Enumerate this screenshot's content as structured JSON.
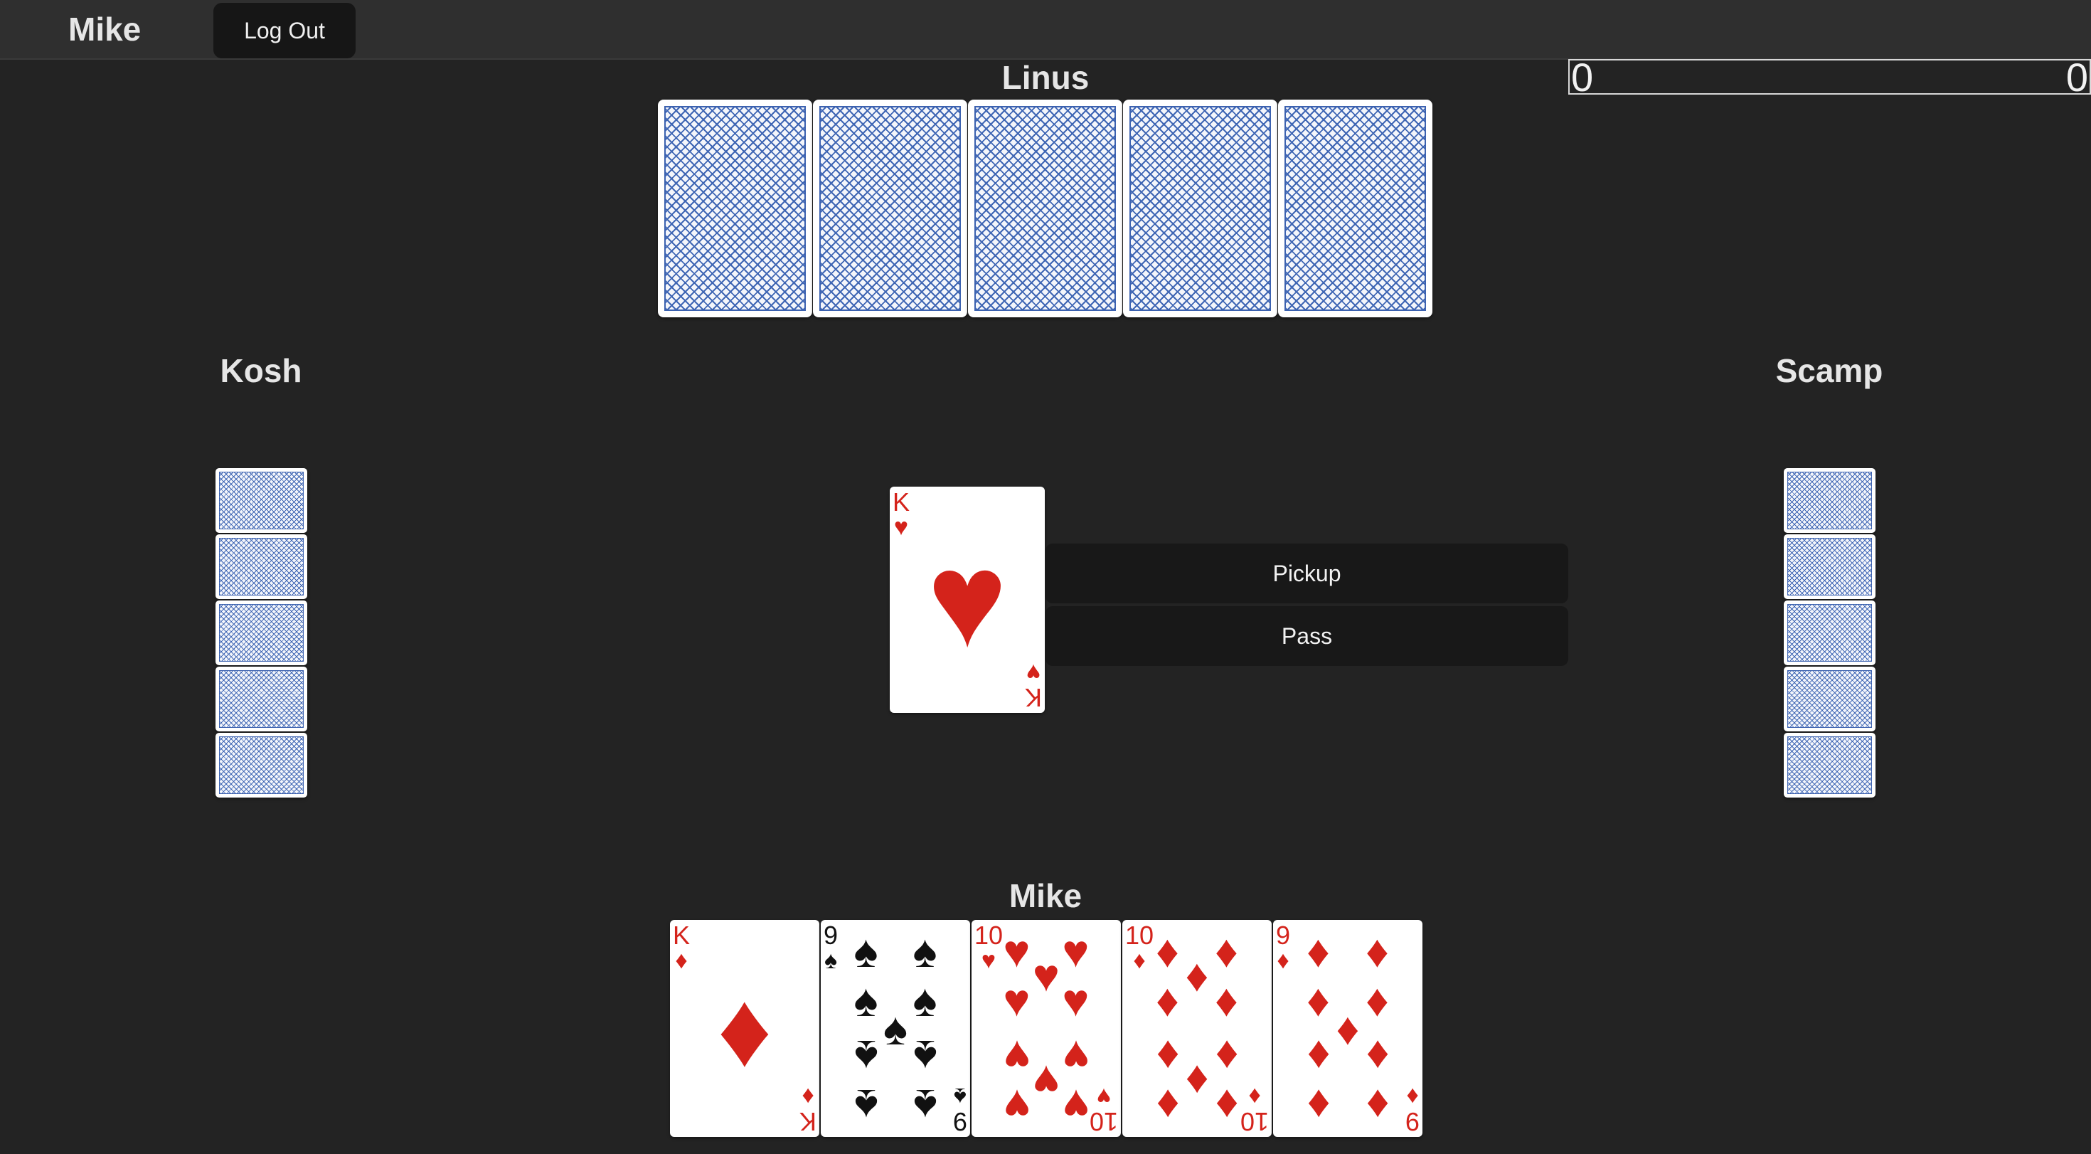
{
  "header": {
    "user_name": "Mike",
    "logout_label": "Log Out"
  },
  "scoreboard": {
    "team_a_score": "0",
    "team_b_score": "0"
  },
  "players": {
    "north": {
      "name": "Linus",
      "card_count": 5
    },
    "west": {
      "name": "Kosh",
      "card_count": 5
    },
    "east": {
      "name": "Scamp",
      "card_count": 5
    },
    "south": {
      "name": "Mike"
    }
  },
  "turned_up_card": {
    "rank": "K",
    "suit": "♥",
    "color": "red"
  },
  "actions": {
    "pickup_label": "Pickup",
    "pass_label": "Pass"
  },
  "hand": [
    {
      "rank": "K",
      "suit": "♦",
      "color": "red",
      "pips": 0
    },
    {
      "rank": "9",
      "suit": "♠",
      "color": "black",
      "pips": 9
    },
    {
      "rank": "10",
      "suit": "♥",
      "color": "red",
      "pips": 10
    },
    {
      "rank": "10",
      "suit": "♦",
      "color": "red",
      "pips": 10
    },
    {
      "rank": "9",
      "suit": "♦",
      "color": "red",
      "pips": 9
    }
  ],
  "colors": {
    "table": "#232323",
    "card_back": "#3f66b4",
    "red_suit": "#d4231b"
  }
}
